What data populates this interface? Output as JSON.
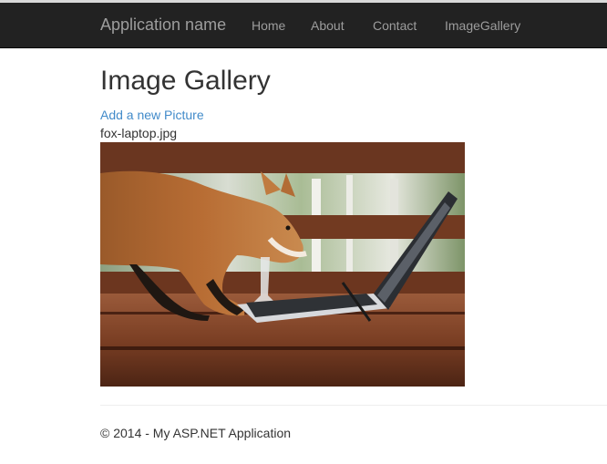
{
  "navbar": {
    "brand": "Application name",
    "links": [
      {
        "label": "Home"
      },
      {
        "label": "About"
      },
      {
        "label": "Contact"
      },
      {
        "label": "ImageGallery"
      }
    ]
  },
  "main": {
    "title": "Image Gallery",
    "add_link": "Add a new Picture",
    "images": [
      {
        "file_name": "fox-laptop.jpg"
      }
    ]
  },
  "footer": {
    "text": "© 2014 - My ASP.NET Application"
  },
  "colors": {
    "navbar_background": "#222222",
    "navbar_text": "#9d9d9d",
    "link": "#428bca",
    "text": "#333333"
  }
}
